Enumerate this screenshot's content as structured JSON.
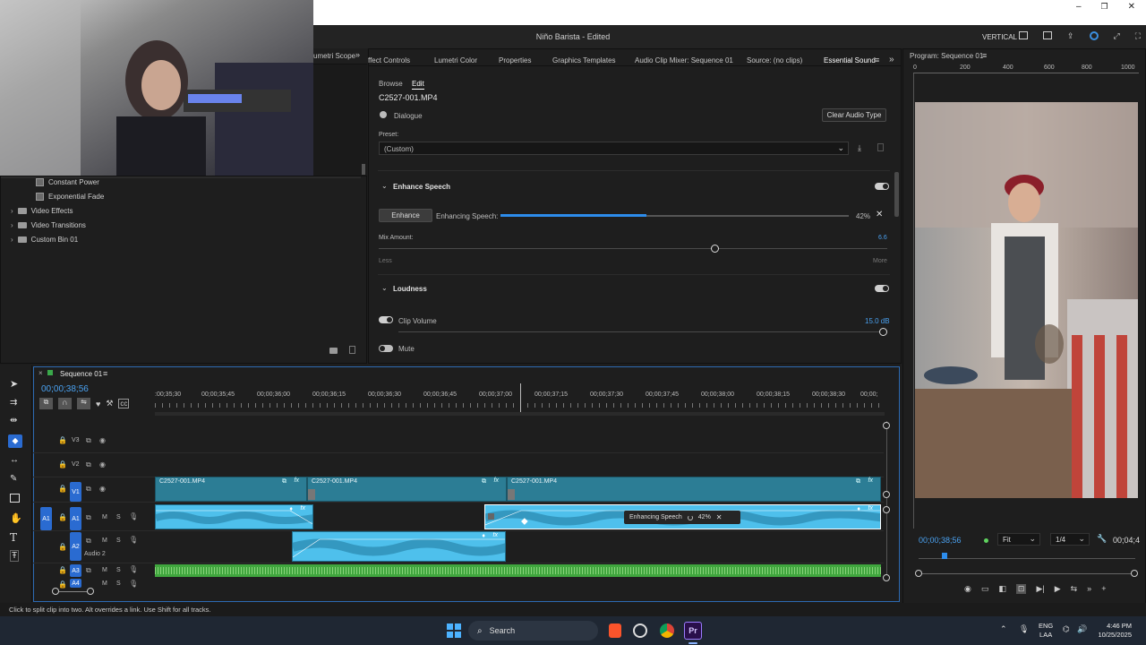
{
  "window": {
    "title": "Niño Barista - Edited",
    "workspace": "VERTICAL",
    "controls": [
      "minimize",
      "maximize",
      "close"
    ]
  },
  "panel_tabs": {
    "left_partial": "umetri Scope",
    "main": [
      "Effect Controls",
      "Lumetri Color",
      "Properties",
      "Graphics Templates",
      "Audio Clip Mixer: Sequence 01",
      "Source: (no clips)",
      "Essential Sound"
    ],
    "main_display": [
      "ffect Controls",
      "Lumetri Color",
      "Properties",
      "Graphics Templates",
      "Audio Clip Mixer: Sequence 01",
      "Source: (no clips)",
      "Essential Sound"
    ],
    "program": "Program: Sequence 01"
  },
  "effects_panel": {
    "items": [
      {
        "label": "Constant Power",
        "type": "effect"
      },
      {
        "label": "Exponential Fade",
        "type": "effect"
      },
      {
        "label": "Video Effects",
        "type": "folder"
      },
      {
        "label": "Video Transitions",
        "type": "folder"
      },
      {
        "label": "Custom Bin 01",
        "type": "folder"
      }
    ]
  },
  "essential_sound": {
    "subtabs": [
      "Browse",
      "Edit"
    ],
    "active_subtab": "Edit",
    "clip_name": "C2527-001.MP4",
    "audio_type": "Dialogue",
    "clear_button": "Clear Audio Type",
    "preset_label": "Preset:",
    "preset_value": "(Custom)",
    "enhance_section": "Enhance Speech",
    "enhance_button": "Enhance",
    "enhancing_label": "Enhancing Speech:",
    "enhance_progress": 0.42,
    "enhance_percent": "42%",
    "mix_label": "Mix Amount:",
    "mix_value": "6.6",
    "mix_fraction": 0.66,
    "mix_less": "Less",
    "mix_more": "More",
    "loudness_section": "Loudness",
    "clip_volume_label": "Clip Volume",
    "clip_volume_value": "15.0 dB",
    "mute_label": "Mute"
  },
  "program_monitor": {
    "ruler": [
      "0",
      "200",
      "400",
      "600",
      "800",
      "1000"
    ],
    "timecode": "00;00;38;56",
    "fit": "Fit",
    "resolution": "1/4",
    "duration": "00;04;4"
  },
  "timeline": {
    "sequence": "Sequence 01",
    "timecode": "00;00;38;56",
    "ruler": [
      ":00;35;30",
      "00;00;35;45",
      "00;00;36;00",
      "00;00;36;15",
      "00;00;36;30",
      "00;00;36;45",
      "00;00;37;00",
      "00;00;37;15",
      "00;00;37;30",
      "00;00;37;45",
      "00;00;38;00",
      "00;00;38;15",
      "00;00;38;30",
      "00;00;"
    ],
    "tracks": {
      "v3": "V3",
      "v2": "V2",
      "v1": "V1",
      "a1_src": "A1",
      "a1": "A1",
      "a2": "A2",
      "a3": "A3",
      "a4": "A4",
      "a2_name": "Audio 2",
      "m": "M",
      "s": "S"
    },
    "clips": {
      "v1_c1": "C2527-001.MP4",
      "v1_c2": "C2527-001.MP4",
      "v1_c3": "C2527-001.MP4",
      "fx": "fx"
    },
    "enhancing_tooltip": "Enhancing Speech",
    "enhancing_tooltip_percent": "42%"
  },
  "status_bar": "Click to split clip into two. Alt overrides a link. Use Shift for all tracks.",
  "taskbar": {
    "search": "Search",
    "lang_top": "ENG",
    "lang_bottom": "LAA",
    "time": "4:46 PM",
    "date": "10/25/2025",
    "pr": "Pr"
  },
  "colors": {
    "accent_blue": "#2d8ceb",
    "clip_video": "#2c7d95",
    "clip_audio": "#4ec0ec",
    "clip_music": "#40a63e"
  }
}
